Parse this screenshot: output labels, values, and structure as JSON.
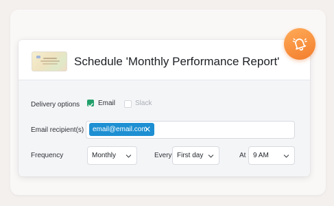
{
  "dialog": {
    "title": "Schedule 'Monthly Performance Report'",
    "thumbnail": "report-thumbnail"
  },
  "delivery": {
    "label": "Delivery options",
    "options": [
      {
        "label": "Email",
        "checked": true
      },
      {
        "label": "Slack",
        "checked": false
      }
    ]
  },
  "recipients": {
    "label": "Email recipient(s)",
    "chips": [
      "email@email.com"
    ]
  },
  "frequency": {
    "label": "Frequency",
    "value": "Monthly",
    "every_label": "Every",
    "every_value": "First day",
    "at_label": "At",
    "at_value": "9 AM"
  },
  "icons": {
    "bell": "bell-icon",
    "check": "check-icon",
    "remove": "close-icon",
    "dropdown": "chevron-down-icon"
  },
  "colors": {
    "accent_orange": "#f48a36",
    "check_green": "#22a06b",
    "chip_blue": "#1d8fd2"
  }
}
